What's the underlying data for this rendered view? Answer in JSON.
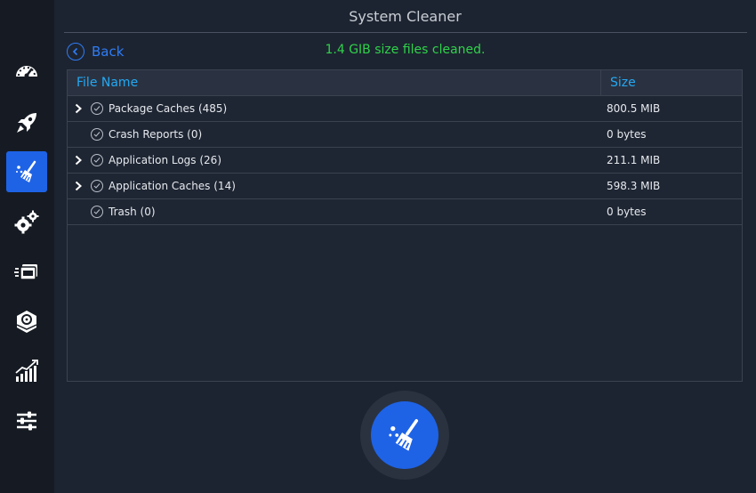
{
  "window": {
    "title": "System Cleaner"
  },
  "header": {
    "back_label": "Back",
    "status_text": "1.4 GIB size files cleaned."
  },
  "sidebar": {
    "items": [
      {
        "icon": "speedometer-icon",
        "active": false
      },
      {
        "icon": "rocket-icon",
        "active": false
      },
      {
        "icon": "broom-icon",
        "active": true
      },
      {
        "icon": "gears-icon",
        "active": false
      },
      {
        "icon": "stack-icon",
        "active": false
      },
      {
        "icon": "disk-package-icon",
        "active": false
      },
      {
        "icon": "chart-icon",
        "active": false
      },
      {
        "icon": "sliders-icon",
        "active": false
      }
    ]
  },
  "table": {
    "columns": [
      "File Name",
      "Size"
    ],
    "rows": [
      {
        "name": "Package Caches (485)",
        "size": "800.5 MIB",
        "expandable": true
      },
      {
        "name": "Crash Reports (0)",
        "size": "0 bytes",
        "expandable": false
      },
      {
        "name": "Application Logs (26)",
        "size": "211.1 MIB",
        "expandable": true
      },
      {
        "name": "Application Caches (14)",
        "size": "598.3 MIB",
        "expandable": true
      },
      {
        "name": "Trash (0)",
        "size": "0 bytes",
        "expandable": false
      }
    ]
  },
  "colors": {
    "accent": "#1e63e6",
    "link": "#2e7df6",
    "success": "#2fd24a",
    "header_text": "#25a8f2"
  },
  "action_button": {
    "icon": "broom-icon"
  }
}
